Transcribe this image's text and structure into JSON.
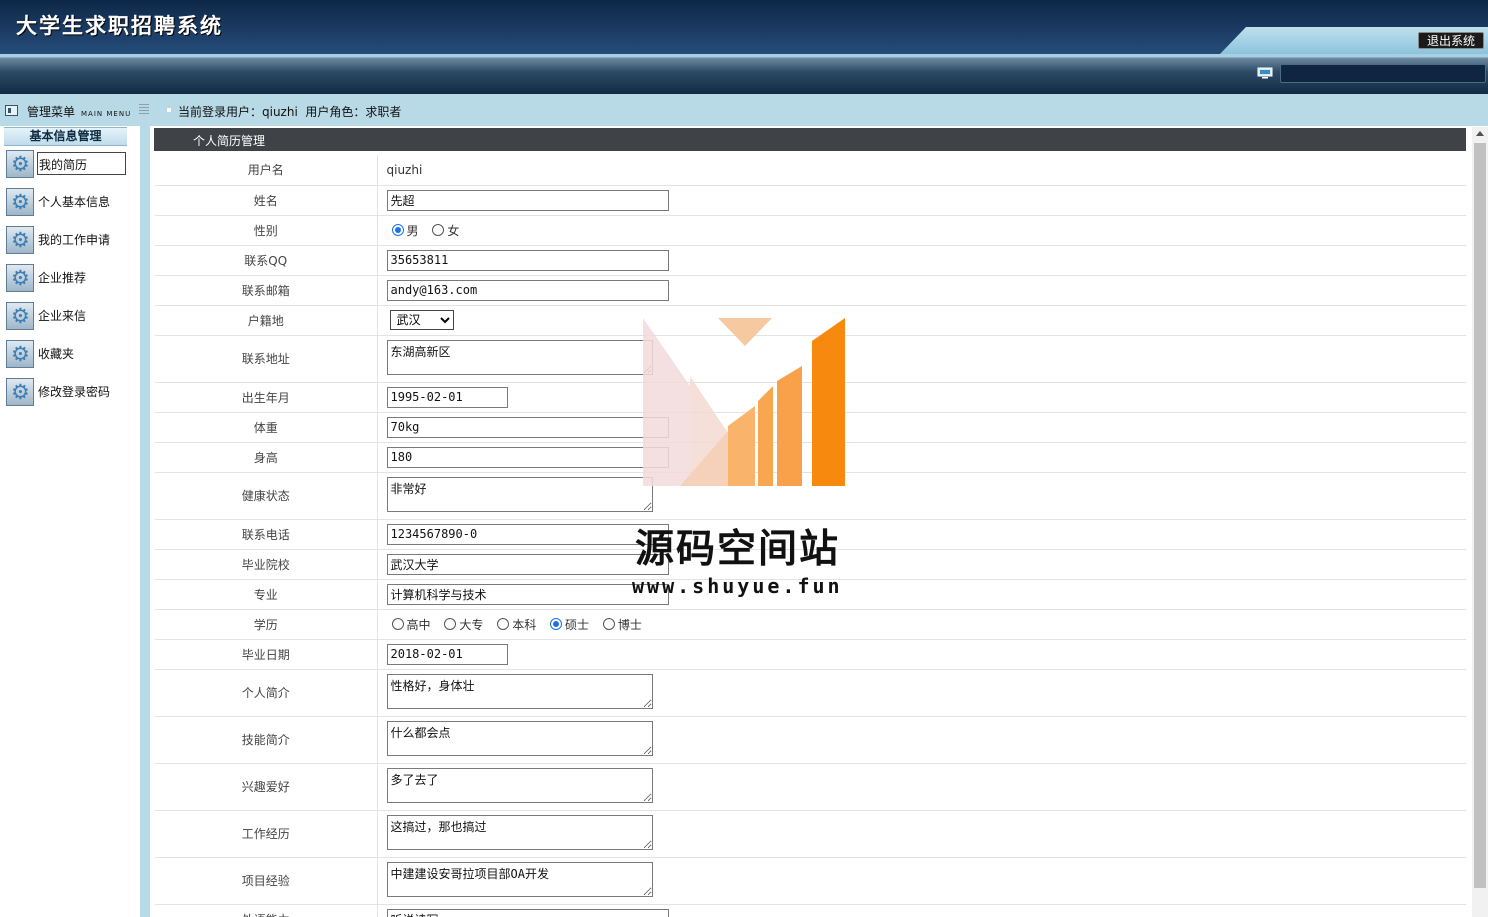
{
  "header": {
    "app_title": "大学生求职招聘系统",
    "logout_label": "退出系统"
  },
  "infobar": {
    "menu_title": "管理菜单",
    "menu_title_en": "MAIN MENU",
    "user_info": "当前登录用户：qiuzhi  用户角色：求职者"
  },
  "sidebar": {
    "section_title": "基本信息管理",
    "items": [
      {
        "label": "我的简历"
      },
      {
        "label": "个人基本信息"
      },
      {
        "label": "我的工作申请"
      },
      {
        "label": "企业推荐"
      },
      {
        "label": "企业来信"
      },
      {
        "label": "收藏夹"
      },
      {
        "label": "修改登录密码"
      }
    ]
  },
  "panel": {
    "title": "个人简历管理"
  },
  "form": {
    "username_label": "用户名",
    "username_value": "qiuzhi",
    "name_label": "姓名",
    "name_value": "先超",
    "gender_label": "性别",
    "gender_options": [
      "男",
      "女"
    ],
    "gender_selected": "男",
    "qq_label": "联系QQ",
    "qq_value": "35653811",
    "email_label": "联系邮箱",
    "email_value": "andy@163.com",
    "hukou_label": "户籍地",
    "hukou_value": "武汉",
    "address_label": "联系地址",
    "address_value": "东湖高新区",
    "birth_label": "出生年月",
    "birth_value": "1995-02-01",
    "weight_label": "体重",
    "weight_value": "70kg",
    "height_label": "身高",
    "height_value": "180",
    "health_label": "健康状态",
    "health_value": "非常好",
    "phone_label": "联系电话",
    "phone_value": "1234567890-0",
    "school_label": "毕业院校",
    "school_value": "武汉大学",
    "major_label": "专业",
    "major_value": "计算机科学与技术",
    "education_label": "学历",
    "education_options": [
      "高中",
      "大专",
      "本科",
      "硕士",
      "博士"
    ],
    "education_selected": "硕士",
    "gradate_label": "毕业日期",
    "gradate_value": "2018-02-01",
    "intro_label": "个人简介",
    "intro_value": "性格好，身体壮",
    "skills_label": "技能简介",
    "skills_value": "什么都会点",
    "hobbies_label": "兴趣爱好",
    "hobbies_value": "多了去了",
    "work_label": "工作经历",
    "work_value": "这搞过，那也搞过",
    "project_label": "项目经验",
    "project_value": "中建建设安哥拉项目部OA开发",
    "foreign_label": "外语能力",
    "foreign_value": "听说读写"
  },
  "watermark": {
    "text": "源码空间站",
    "url": "www.shuyue.fun",
    "colors": {
      "orange": "#f7890f",
      "light_orange": "#f9b36a",
      "pink": "#f2dada"
    }
  }
}
